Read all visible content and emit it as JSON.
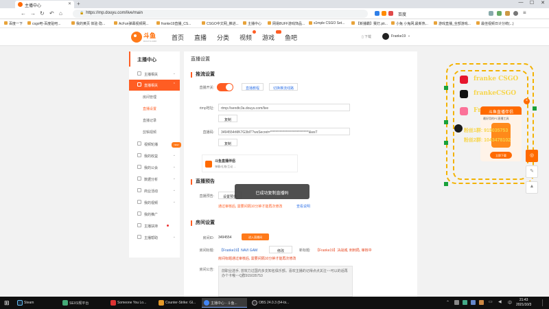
{
  "browser": {
    "tab_title": "主播中心",
    "url": "https://mp.douyu.com/live/main",
    "ext_label": "百度",
    "bookmarks": [
      "百度一下",
      "csgo吧-百度贴吧...",
      "我的黄页 体验·隐...",
      "AcFun弹幕视频网...",
      "franke19直播_CS...",
      "CSGO中文网_推进...",
      "主播中心",
      "网易BUFF游戏饰品...",
      "s1mple CSGO Set...",
      "【新播霸】赛灯.pti...",
      "小兔 小兔网,最新热...",
      "游戏直播_全部游戏...",
      "最佳视频日计分统(...)"
    ]
  },
  "site": {
    "logo_text": "斗鱼",
    "logo_sub": "DOUYU.COM",
    "nav": [
      "首页",
      "直播",
      "分类",
      "视频",
      "游戏",
      "鱼吧"
    ],
    "download": "下载",
    "username": "Franke19"
  },
  "sidebar": {
    "title": "主播中心",
    "items": [
      {
        "label": "主播相关"
      },
      {
        "label": "直播相关"
      },
      {
        "label": "房间管理"
      },
      {
        "label": "直播设置"
      },
      {
        "label": "直播记录"
      },
      {
        "label": "剪辑视频"
      },
      {
        "label": "视频轮播"
      },
      {
        "label": "我的收益"
      },
      {
        "label": "我的公会"
      },
      {
        "label": "数据分析"
      },
      {
        "label": "商业活动"
      },
      {
        "label": "我的视频"
      },
      {
        "label": "我的推广"
      },
      {
        "label": "主播扶持"
      },
      {
        "label": "主播帮助"
      }
    ],
    "new_badge": "NEW"
  },
  "main": {
    "page_title": "直播设置",
    "push": {
      "title": "推流设置",
      "switch_label": "直播开关:",
      "link1": "直播教程",
      "link2": "切换推流线路",
      "rtmp_label": "rtmp地址:",
      "rtmp_value": "rtmp://sendtc3a.douyu.com/live",
      "copy": "复制",
      "code_label": "直播码:",
      "code_value": "3494554rMK7G3bIT?wsSecret=*****************************&wsT",
      "tool_title": "斗鱼直播伴侣",
      "tool_sub": "弹幕/礼物/互动 ..."
    },
    "preview": {
      "title": "直播预告",
      "label": "直播预告:",
      "button": "设置预告",
      "notice": "通过审核后, 需要间隔10分钟才能再次修改",
      "link": "查看说明"
    },
    "room": {
      "title": "房间设置",
      "id_label": "房间ID:",
      "id_value": "3494554",
      "enter_btn": "进入直播间",
      "title_label": "房间标题:",
      "title_value": "【Franke19】NAVI GAM",
      "edit": "修改",
      "new_title_label": "新标题:",
      "new_title_value": "【Franke19】决战城, 刺刺局, 审核中",
      "title_notice": "房间标题通过审核后, 需要间隔10分钟才能再次修改",
      "notice_label": "房间公告:",
      "notice_text": "前职业选手, 曾效力过国内多支知名俱乐部。喜欢主播的记得点点关注~~可以的话再办个卡哦~~Q群915035753"
    }
  },
  "toast": "已成功复制直播码",
  "overlay": {
    "weibo": "franke CSGO",
    "tiktok": "frankeCSGO",
    "bili": "Franke19",
    "promo_tag": "斗鱼直播伴侣",
    "promo_sub": "最好用的PC直播工具",
    "download": "立即下载",
    "fan_group1": "粉丝1群: 915035753",
    "fan_group2": "粉丝2群: 1043478102"
  },
  "taskbar": {
    "apps": [
      "Steam",
      "SEXS规平台",
      "Someone You Lo...",
      "Counter-Strike: Gl...",
      "主播中心 - 斗鱼...",
      "OBS 24.0.3 (64-bi..."
    ],
    "time": "21:43",
    "date": "2021/10/3"
  },
  "colors": {
    "accent": "#ff5d23",
    "link": "#3b7ae8",
    "highlight": "#f7d54a"
  }
}
